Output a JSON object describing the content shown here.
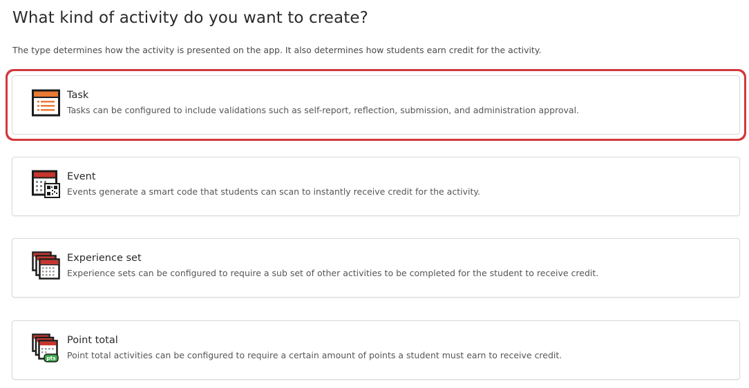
{
  "page": {
    "title": "What kind of activity do you want to create?",
    "subtitle": "The type determines how the activity is presented on the app. It also determines how students earn credit for the activity."
  },
  "options": [
    {
      "title": "Task",
      "description": "Tasks can be configured to include validations such as self-report, reflection, submission, and administration approval.",
      "icon": "task-list-icon",
      "selected": true
    },
    {
      "title": "Event",
      "description": "Events generate a smart code that students can scan to instantly receive credit for the activity.",
      "icon": "calendar-qr-icon",
      "selected": false
    },
    {
      "title": "Experience set",
      "description": "Experience sets can be configured to require a sub set of other activities to be completed for the student to receive credit.",
      "icon": "stacked-calendars-icon",
      "selected": false
    },
    {
      "title": "Point total",
      "description": "Point total activities can be configured to require a certain amount of points a student must earn to receive credit.",
      "icon": "calendars-points-icon",
      "selected": false,
      "icon_badge": "pts"
    }
  ],
  "colors": {
    "selection_outline": "#d1383d",
    "task_accent": "#e97a35",
    "calendar_accent": "#c8352d",
    "points_badge": "#3aa64b"
  }
}
